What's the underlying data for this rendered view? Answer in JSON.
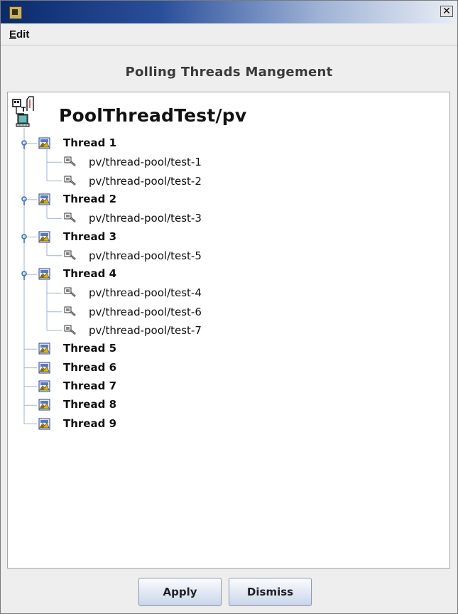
{
  "window": {
    "close_glyph": "✕",
    "colors": {
      "title_left": "#0b2a6b",
      "title_right": "#e9eef6",
      "background": "#eeeeee"
    }
  },
  "menubar": {
    "edit_mnemonic": "E",
    "edit_rest": "dit"
  },
  "panel": {
    "title": "Polling Threads Mangement"
  },
  "tree": {
    "root": {
      "label": "PoolThreadTest/pv",
      "icon": "server-terminal-icon"
    },
    "threads": [
      {
        "label": "Thread 1",
        "expanded": true,
        "devices": [
          "pv/thread-pool/test-1",
          "pv/thread-pool/test-2"
        ]
      },
      {
        "label": "Thread 2",
        "expanded": true,
        "devices": [
          "pv/thread-pool/test-3"
        ]
      },
      {
        "label": "Thread 3",
        "expanded": true,
        "devices": [
          "pv/thread-pool/test-5"
        ]
      },
      {
        "label": "Thread 4",
        "expanded": true,
        "devices": [
          "pv/thread-pool/test-4",
          "pv/thread-pool/test-6",
          "pv/thread-pool/test-7"
        ]
      },
      {
        "label": "Thread 5",
        "expanded": false,
        "devices": []
      },
      {
        "label": "Thread 6",
        "expanded": false,
        "devices": []
      },
      {
        "label": "Thread 7",
        "expanded": false,
        "devices": []
      },
      {
        "label": "Thread 8",
        "expanded": false,
        "devices": []
      },
      {
        "label": "Thread 9",
        "expanded": false,
        "devices": []
      }
    ]
  },
  "buttons": {
    "apply": "Apply",
    "dismiss": "Dismiss"
  }
}
